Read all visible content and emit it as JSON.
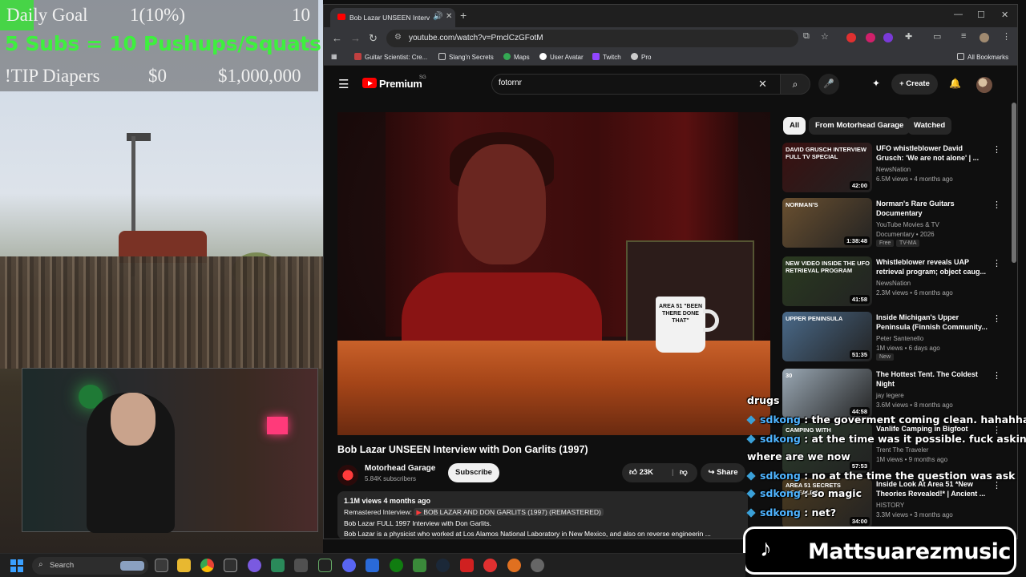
{
  "overlay": {
    "goal_label": "Daily Goal",
    "goal_progress": "1(10%)",
    "goal_target": "10",
    "subs_line": "5 Subs = 10 Pushups/Squats",
    "tip_label": "!TIP Diapers",
    "tip_current": "$0",
    "tip_goal": "$1,000,000"
  },
  "browser": {
    "tab_title": "Bob Lazar UNSEEN Intervie",
    "url": "youtube.com/watch?v=PmclCzGFotM",
    "bookmarks": [
      "Guitar Scientist: Cre...",
      "Slang'n Secrets",
      "Maps",
      "User Avatar",
      "Twitch",
      "Pro"
    ],
    "all_bookmarks": "All Bookmarks"
  },
  "youtube": {
    "brand": "Premium",
    "region": "SG",
    "search_value": "fotornr",
    "create_label": "Create",
    "video": {
      "title": "Bob Lazar UNSEEN Interview with Don Garlits (1997)",
      "channel": "Motorhead Garage",
      "subscribers": "5.84K subscribers",
      "subscribe_label": "Subscribe",
      "likes": "23K",
      "share_label": "Share",
      "mug_text": "AREA 51 \"BEEN THERE DONE THAT\"",
      "desc_meta": "1.1M views  4 months ago",
      "desc_remastered_prefix": "Remastered Interview:",
      "desc_remastered_link": "BOB LAZAR AND DON GARLITS (1997) (REMASTERED)",
      "desc_line3": "Bob Lazar FULL 1997 Interview with Don Garlits.",
      "desc_line4": "Bob Lazar is a physicist who worked at Los Alamos National Laboratory in New Mexico, and also on reverse engineerin ..."
    },
    "chips": [
      "All",
      "From Motorhead Garage",
      "Watched"
    ],
    "recommendations": [
      {
        "title": "UFO whistleblower David Grusch: 'We are not alone' | ...",
        "channel": "NewsNation",
        "views": "6.5M views • 4 months ago",
        "duration": "42:00",
        "thumb_text": "DAVID GRUSCH INTERVIEW FULL TV SPECIAL",
        "thumb_color": "#3a1010"
      },
      {
        "title": "Norman's Rare Guitars Documentary",
        "channel": "YouTube Movies & TV",
        "views": "Documentary • 2026",
        "duration": "1:38:48",
        "thumb_text": "NORMAN'S",
        "thumb_color": "#6a5030",
        "badge1": "Free",
        "badge2": "TV-MA"
      },
      {
        "title": "Whistleblower reveals UAP retrieval program; object caug...",
        "channel": "NewsNation",
        "views": "2.3M views • 6 months ago",
        "duration": "41:58",
        "thumb_text": "NEW VIDEO INSIDE THE UFO RETRIEVAL PROGRAM",
        "thumb_color": "#2a3a20"
      },
      {
        "title": "Inside Michigan's Upper Peninsula (Finnish Community...",
        "channel": "Peter Santenello",
        "views": "1M views • 6 days ago",
        "duration": "51:35",
        "thumb_text": "UPPER PENINSULA",
        "thumb_color": "#4a6a8a",
        "badge1": "New"
      },
      {
        "title": "The Hottest Tent. The Coldest Night",
        "channel": "jay legere",
        "views": "3.6M views • 8 months ago",
        "duration": "44:58",
        "thumb_text": "30",
        "thumb_color": "#9aa8b4"
      },
      {
        "title": "Vanlife Camping in Bigfoot",
        "channel": "Trent The Traveler",
        "views": "1M views • 9 months ago",
        "duration": "57:53",
        "thumb_text": "CAMPING WITH",
        "thumb_color": "#2a3a2a"
      },
      {
        "title": "Inside Look At Area 51 *New Theories Revealed!* | Ancient ...",
        "channel": "HISTORY",
        "views": "3.3M views • 3 months ago",
        "duration": "34:00",
        "thumb_text": "AREA 51 SECRETS REVEALED",
        "thumb_color": "#4a3a20"
      }
    ]
  },
  "chat": [
    {
      "user": "",
      "text": "drugs"
    },
    {
      "user": "sdkong",
      "text": ": the goverment coming clean. hahahhahha"
    },
    {
      "user": "sdkong",
      "text": ": at the time was it possible. fuck asking"
    },
    {
      "user": "",
      "text": "where are we now"
    },
    {
      "user": "sdkong",
      "text": ": no at the time the question was ask"
    },
    {
      "user": "sdkong",
      "text": ": so magic"
    },
    {
      "user": "sdkong",
      "text": ": net?"
    }
  ],
  "tiktok": {
    "handle": "Mattsuarezmusic"
  },
  "taskbar": {
    "search_label": "Search"
  }
}
